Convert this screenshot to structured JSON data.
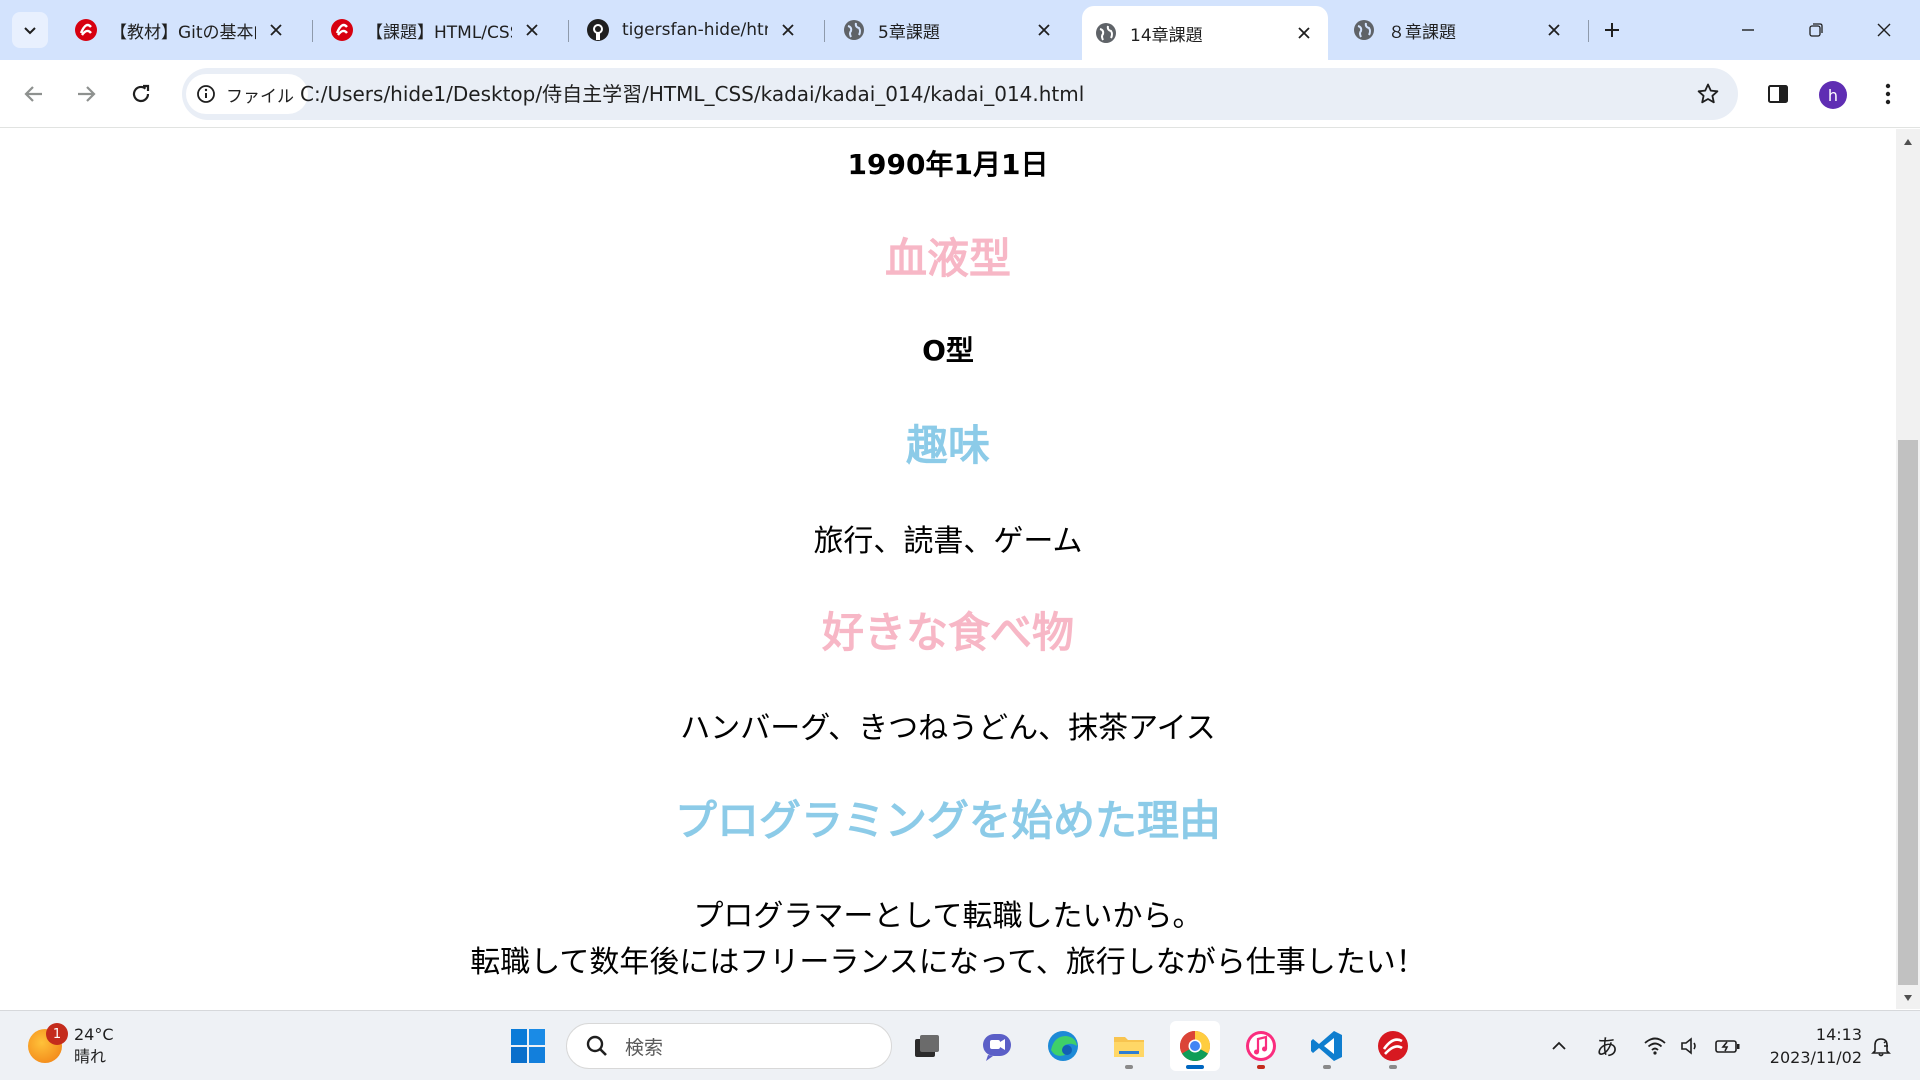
{
  "browser": {
    "tabs": [
      {
        "title": "【教材】Gitの基本的",
        "icon": "samurai-logo-icon",
        "active": false
      },
      {
        "title": "【課題】HTML/CSSの",
        "icon": "samurai-logo-icon",
        "active": false
      },
      {
        "title": "tigersfan-hide/htm",
        "icon": "github-icon",
        "active": false
      },
      {
        "title": "5章課題",
        "icon": "globe-icon",
        "active": false
      },
      {
        "title": "14章課題",
        "icon": "globe-icon",
        "active": true
      },
      {
        "title": "８章課題",
        "icon": "globe-icon",
        "active": false
      }
    ],
    "site_chip_label": "ファイル",
    "url": "C:/Users/hide1/Desktop/侍自主学習/HTML_CSS/kadai/kadai_014/kadai_014.html",
    "profile_initial": "h"
  },
  "page": {
    "birthday_value": "1990年1月1日",
    "blood_heading": "血液型",
    "blood_value": "O型",
    "hobby_heading": "趣味",
    "hobby_value": "旅行、読書、ゲーム",
    "food_heading": "好きな食べ物",
    "food_value": "ハンバーグ、きつねうどん、抹茶アイス",
    "reason_heading": "プログラミングを始めた理由",
    "reason_line1": "プログラマーとして転職したいから。",
    "reason_line2": "転職して数年後にはフリーランスになって、旅行しながら仕事したい！"
  },
  "colors": {
    "heading_pink": "#f7b7c6",
    "heading_blue": "#8ccbe8",
    "tab_strip": "#d3e3fd",
    "accent": "#0067c0"
  },
  "taskbar": {
    "weather_temp": "24°C",
    "weather_desc": "晴れ",
    "weather_badge": "1",
    "search_placeholder": "検索",
    "ime_indicator": "あ",
    "time": "14:13",
    "date": "2023/11/02"
  }
}
